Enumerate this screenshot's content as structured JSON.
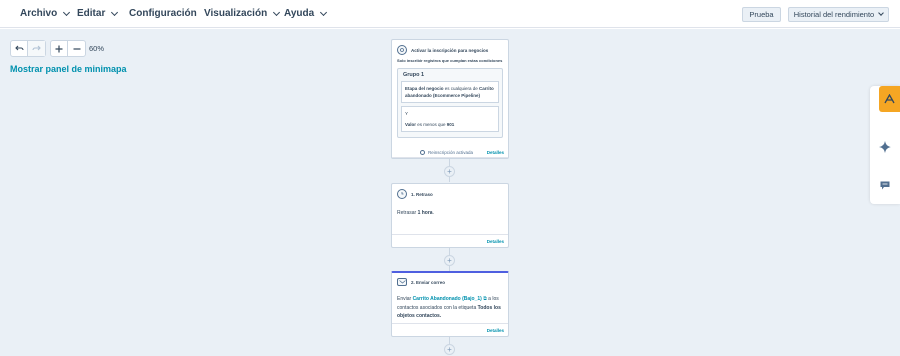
{
  "menu": {
    "archivo": "Archivo",
    "editar": "Editar",
    "configuracion": "Configuración",
    "visualizacion": "Visualización",
    "ayuda": "Ayuda"
  },
  "header_buttons": {
    "test": "Prueba",
    "history": "Historial del rendimiento"
  },
  "zoom": {
    "level": "60%",
    "minimap_link": "Mostrar panel de minimapa"
  },
  "trigger_card": {
    "title": "Activar la inscripción para negocios",
    "subtitle": "Solo inscribir registros que cumplan estas condiciones",
    "group_title": "Grupo 1",
    "cond1_label": "Etapa del negocio",
    "cond1_text": " es cualquiera de ",
    "cond1_value": "Carrito abandonado (Ecommerce Pipeline)",
    "cond2_and": "Y",
    "cond2_label": "Valor",
    "cond2_text": " es menos que ",
    "cond2_value": "901",
    "reenroll": "Reinscripción activada",
    "details": "Detalles"
  },
  "delay_card": {
    "title": "1. Retraso",
    "body_prefix": "Retrasar ",
    "body_value": "1 hora",
    "body_suffix": ".",
    "details": "Detalles"
  },
  "email_card": {
    "title": "2. Enviar correo",
    "body_prefix": "Enviar ",
    "email_link": "Carrito Abandonado (Bajo_1)",
    "body_mid": " a los contactos asociados con la etiqueta ",
    "body_label": "Todos los objetos contactos.",
    "details": "Detalles"
  },
  "colors": {
    "accent_link": "#0091ae",
    "canvas_bg": "#eaf0f6",
    "active_border": "#4f5fe0",
    "rail_accent": "#f5a623"
  },
  "icons": {
    "undo": "undo-icon",
    "redo": "redo-icon",
    "zoom_in": "plus-icon",
    "zoom_out": "minus-icon",
    "assistant": "sparkle-icon",
    "chat": "chat-icon"
  }
}
